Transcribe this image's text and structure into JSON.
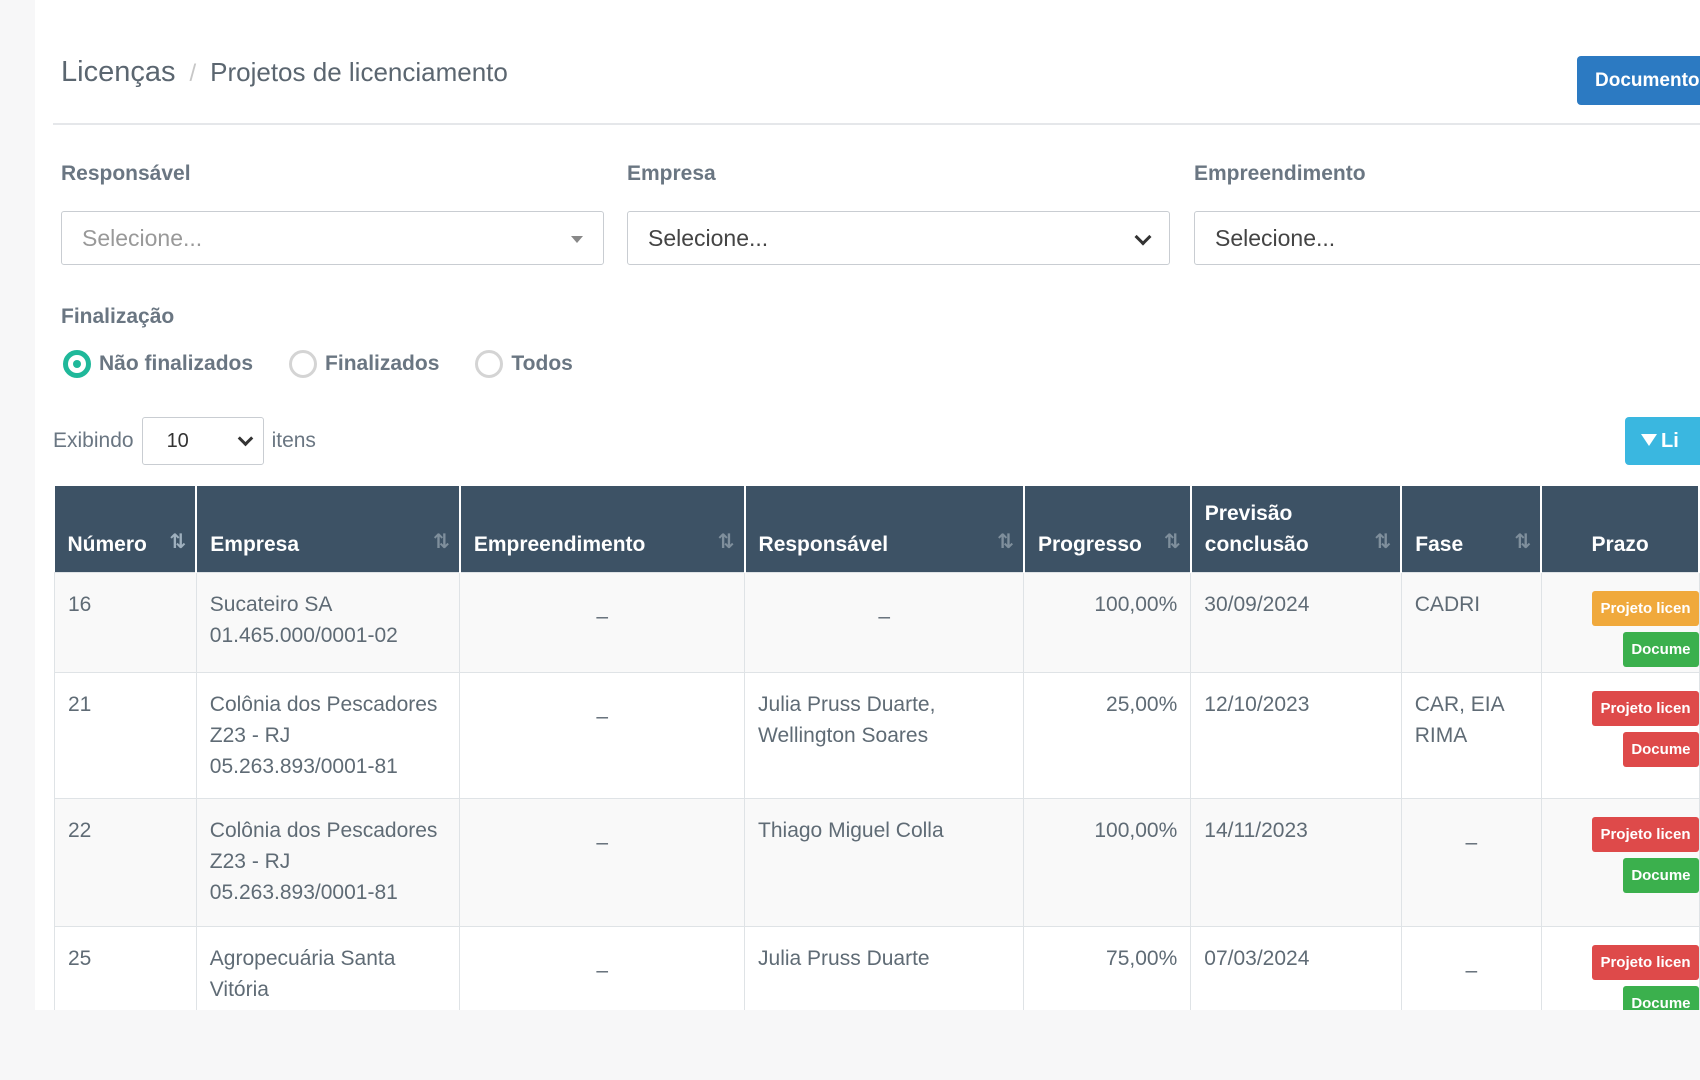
{
  "breadcrumb": {
    "root": "Licenças",
    "separator": "/",
    "current": "Projetos de licenciamento"
  },
  "header": {
    "documents_button": "Documentos"
  },
  "filters": {
    "responsavel": {
      "label": "Responsável",
      "placeholder": "Selecione..."
    },
    "empresa": {
      "label": "Empresa",
      "value": "Selecione..."
    },
    "empreendimento": {
      "label": "Empreendimento",
      "value": "Selecione..."
    },
    "finalizacao": {
      "label": "Finalização",
      "options": [
        "Não finalizados",
        "Finalizados",
        "Todos"
      ],
      "selected": "Não finalizados"
    }
  },
  "pagination": {
    "prefix": "Exibindo",
    "page_size": "10",
    "suffix": "itens"
  },
  "filter_button": {
    "label": "Li"
  },
  "table": {
    "columns": [
      "Número",
      "Empresa",
      "Empreendimento",
      "Responsável",
      "Progresso",
      "Previsão conclusão",
      "Fase",
      "Prazo"
    ],
    "rows": [
      {
        "numero": "16",
        "empresa": [
          "Sucateiro SA",
          "01.465.000/0001-02"
        ],
        "empreendimento": "–",
        "responsavel": "–",
        "progresso": "100,00%",
        "previsao": "30/09/2024",
        "fase": "CADRI",
        "prazo_badges": [
          {
            "text": "Projeto licen",
            "color": "#f0a93c"
          },
          {
            "text": "Docume",
            "color": "#3bb04d"
          }
        ]
      },
      {
        "numero": "21",
        "empresa": [
          "Colônia dos Pescadores",
          "Z23 - RJ",
          "05.263.893/0001-81"
        ],
        "empreendimento": "–",
        "responsavel": "Julia Pruss Duarte, Wellington Soares",
        "progresso": "25,00%",
        "previsao": "12/10/2023",
        "fase": "CAR, EIA RIMA",
        "prazo_badges": [
          {
            "text": "Projeto licen",
            "color": "#de4a4a"
          },
          {
            "text": "Docume",
            "color": "#de4a4a"
          }
        ]
      },
      {
        "numero": "22",
        "empresa": [
          "Colônia dos Pescadores",
          "Z23 - RJ",
          "05.263.893/0001-81"
        ],
        "empreendimento": "–",
        "responsavel": "Thiago Miguel Colla",
        "progresso": "100,00%",
        "previsao": "14/11/2023",
        "fase": "–",
        "prazo_badges": [
          {
            "text": "Projeto licen",
            "color": "#de4a4a"
          },
          {
            "text": "Docume",
            "color": "#3bb04d"
          }
        ]
      },
      {
        "numero": "25",
        "empresa": [
          "Agropecuária Santa",
          "Vitória"
        ],
        "empreendimento": "–",
        "responsavel": "Julia Pruss Duarte",
        "progresso": "75,00%",
        "previsao": "07/03/2024",
        "fase": "–",
        "prazo_badges": [
          {
            "text": "Projeto licen",
            "color": "#de4a4a"
          },
          {
            "text": "Docume",
            "color": "#3bb04d"
          }
        ]
      }
    ]
  },
  "colors": {
    "header_bg": "#3d5265",
    "accent_teal": "#1fb89a",
    "docs_button": "#2c7ac2",
    "filter_button": "#3ab7e0"
  }
}
